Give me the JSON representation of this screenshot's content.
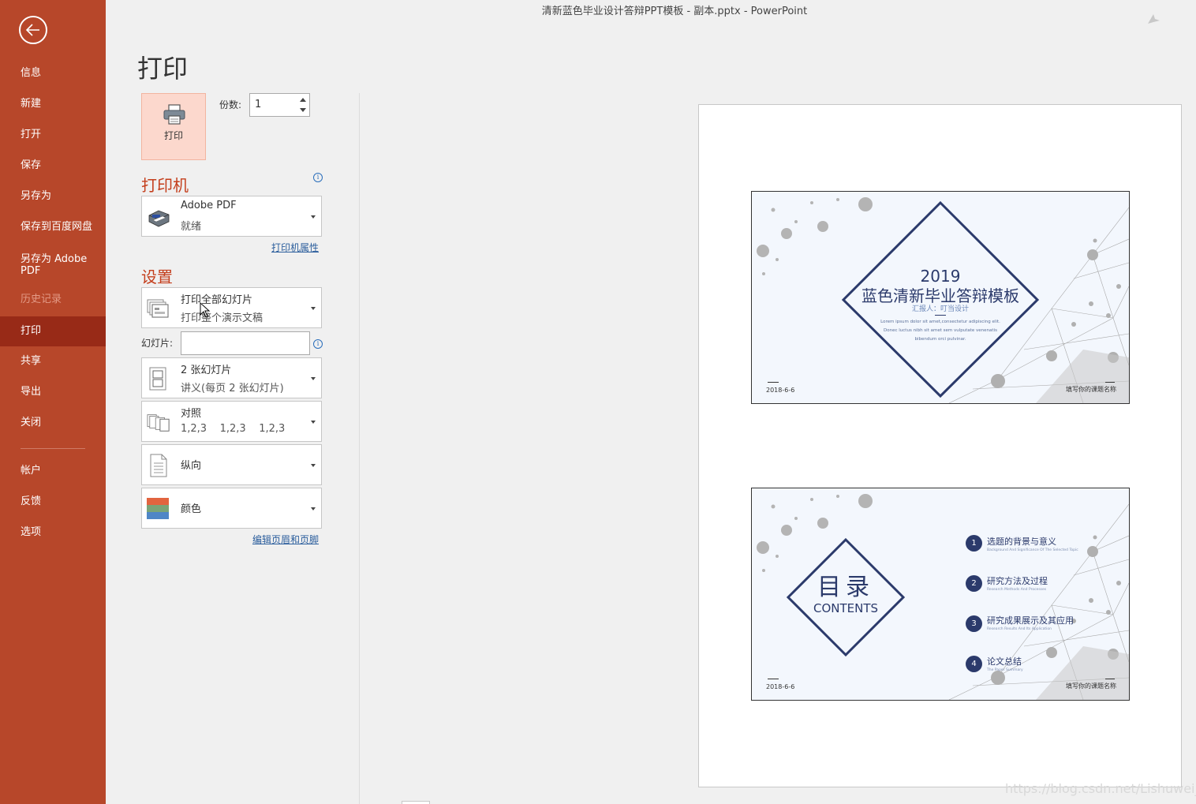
{
  "window": {
    "title": "清新蓝色毕业设计答辩PPT模板 - 副本.pptx  -  PowerPoint"
  },
  "sidebar": {
    "items": [
      {
        "label": "信息"
      },
      {
        "label": "新建"
      },
      {
        "label": "打开"
      },
      {
        "label": "保存"
      },
      {
        "label": "另存为"
      },
      {
        "label": "保存到百度网盘"
      },
      {
        "label": "另存为 Adobe PDF"
      },
      {
        "label": "历史记录"
      },
      {
        "label": "打印"
      },
      {
        "label": "共享"
      },
      {
        "label": "导出"
      },
      {
        "label": "关闭"
      },
      {
        "label": "帐户"
      },
      {
        "label": "反馈"
      },
      {
        "label": "选项"
      }
    ]
  },
  "print": {
    "heading": "打印",
    "button_label": "打印",
    "copies_label": "份数:",
    "copies_value": "1"
  },
  "printer": {
    "heading": "打印机",
    "name": "Adobe PDF",
    "status": "就绪",
    "properties_link": "打印机属性"
  },
  "settings": {
    "heading": "设置",
    "range_title": "打印全部幻灯片",
    "range_sub": "打印整个演示文稿",
    "slides_label": "幻灯片:",
    "slides_value": "",
    "layout_title": "2 张幻灯片",
    "layout_sub": "讲义(每页 2 张幻灯片)",
    "collate_title": "对照",
    "collate_sub": "1,2,3    1,2,3    1,2,3",
    "orientation": "纵向",
    "color": "颜色",
    "header_footer_link": "编辑页眉和页脚"
  },
  "preview": {
    "slide1": {
      "year": "2019",
      "title": "蓝色清新毕业答辩模板",
      "reporter": "汇报人：叮当设计",
      "lorem": "Lorem ipsum dolor sit amet,consectetur adipiscing elit. Donec luctus nibh sit amet sem vulputate venenatis bibendum orci pulvinar.",
      "date": "2018-6-6",
      "author": "填写你的课题名称"
    },
    "slide2": {
      "toc": "目录",
      "contents": "CONTENTS",
      "items": [
        {
          "num": "1",
          "title": "选题的背景与意义",
          "sub": "Background And Significance Of The Selected Topic"
        },
        {
          "num": "2",
          "title": "研究方法及过程",
          "sub": "Research Methods  And Processes"
        },
        {
          "num": "3",
          "title": "研究成果展示及其应用",
          "sub": "Research Results  And Its Application"
        },
        {
          "num": "4",
          "title": "论文总结",
          "sub": "The Paper Summary"
        }
      ],
      "date": "2018-6-6",
      "author": "填写你的课题名称"
    }
  },
  "watermark": "https://blog.csdn.net/Lishuwei_JJ",
  "colors": {
    "sidebar": "#b7472a",
    "accent": "#c43e1c",
    "slide_navy": "#2b3a6b"
  }
}
